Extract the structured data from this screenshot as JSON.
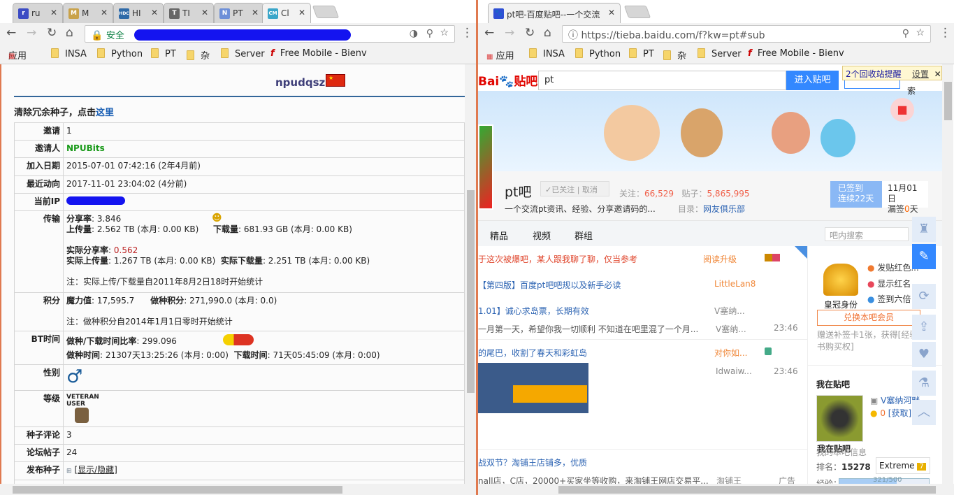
{
  "left_window": {
    "tabs": [
      {
        "label": "ru",
        "favicon": "r"
      },
      {
        "label": "M",
        "favicon": "M"
      },
      {
        "label": "HI",
        "favicon": "HDC"
      },
      {
        "label": "TI",
        "favicon": "T"
      },
      {
        "label": "PT",
        "favicon": "N"
      },
      {
        "label": "Cl",
        "favicon": "CM"
      }
    ],
    "security_label": "安全",
    "profile": {
      "username": "npudqsz",
      "clean_text": "清除冗余种子，点击",
      "clean_link": "这里",
      "rows": {
        "invite_label": "邀请",
        "invite": "1",
        "inviter_label": "邀请人",
        "inviter": "NPUBits",
        "join_label": "加入日期",
        "join": "2015-07-01 07:42:16 (2年4月前)",
        "last_label": "最近动向",
        "last": "2017-11-01 23:04:02 (4分前)",
        "ip_label": "当前IP",
        "transfer_label": "传输",
        "ratio_label": "分享率",
        "ratio": ": 3.846",
        "up_label": "上传量",
        "up": ": 2.562 TB (本月: 0.00 KB)",
        "down_label": "下载量",
        "down": ": 681.93 GB (本月: 0.00 KB)",
        "real_ratio_label": "实际分享率",
        "real_ratio": "0.562",
        "real_up_label": "实际上传量",
        "real_up": ": 1.267 TB (本月: 0.00 KB)",
        "real_down_label": "实际下载量",
        "real_down": ": 2.251 TB (本月: 0.00 KB)",
        "transfer_note": "注：实际上传/下载量自2011年8月2日18时开始统计",
        "points_label": "积分",
        "magic_label": "魔力值",
        "magic": ": 17,595.7",
        "seed_points_label": "做种积分",
        "seed_points": ": 271,990.0 (本月: 0.0)",
        "points_note": "注：做种积分自2014年1月1日零时开始统计",
        "bt_label": "BT时间",
        "bt_ratio_label": "做种/下载时间比率",
        "bt_ratio": ": 299.096",
        "seed_time_label": "做种时间",
        "seed_time": ": 21307天13:25:26 (本月: 0:00)",
        "dl_time_label": "下载时间",
        "dl_time": ": 71天05:45:09 (本月: 0:00)",
        "gender_label": "性别",
        "level_label": "等级",
        "level_badge": "VETERAN USER",
        "comments_label": "种子评论",
        "comments": "3",
        "posts_label": "论坛帖子",
        "posts": "24",
        "released_label": "发布种子",
        "released_toggle": "[显示/隐藏]"
      }
    }
  },
  "right_window": {
    "tab": "pt吧-百度贴吧--一个交流",
    "url": "https://tieba.baidu.com/f?kw=pt#sub",
    "search_value": "pt",
    "enter_button": "进入贴吧",
    "notice": "2个回收站提醒",
    "notice_settings": "设置",
    "notice_extra": "索",
    "forum": {
      "name": "pt吧",
      "follow": "✓已关注",
      "unfollow": "取消",
      "follow_count_label": "关注：",
      "follow_count": "66,529",
      "posts_label": "贴子：",
      "posts": "5,865,995",
      "desc": "一个交流pt资讯、经验、分享邀请码的...",
      "catalog_label": "目录：",
      "catalog": "网友俱乐部",
      "signed": "已签到",
      "streak": "连续22天",
      "date": "11月01日",
      "missed_pre": "漏签",
      "missed": "0",
      "missed_post": "天"
    },
    "nav": [
      "精品",
      "视频",
      "群组"
    ],
    "nav_search_placeholder": "吧内搜索",
    "threads": [
      {
        "title": "于这次被爆吧，某人跟我聊了聊，仅当参考",
        "author": "阅读升级"
      },
      {
        "title": "【第四版】百度pt吧吧规以及新手必读",
        "author": "LittleLan8"
      },
      {
        "title": "1.01】诚心求岛票，长期有效",
        "author": "V塞纳...",
        "summary": "一月第一天，希望你我一切顺利 不知道在吧里混了一个月...",
        "replier": "V塞纳...",
        "time": "23:46"
      },
      {
        "title": "的尾巴，收割了春天和彩虹岛",
        "author": "对你如...",
        "replier": "Idwaiw...",
        "time": "23:46"
      },
      {
        "title": "战双节？淘铺王店铺多，优质",
        "summary": "nall店，C店，20000+买家坐等收购，来淘铺王网店交易平...",
        "author": "淘铺王",
        "tag": "广告"
      }
    ],
    "sidebar": {
      "crown": "皇冠身份",
      "perks": [
        "发贴红色...",
        "显示红名",
        "签到六倍"
      ],
      "exchange": "兑换本吧会员",
      "gift": "赠送补签卡1张，获得[经验书购买权]",
      "my_title": "我在贴吧",
      "user": "V塞纳河畔",
      "coins": "0",
      "get": "[获取]",
      "my_info": "我的本吧信息",
      "rank_label": "排名：",
      "rank": "15278",
      "level_name": "Extreme",
      "level_num": "7",
      "exp_label": "经验：",
      "exp": "321/500",
      "exp_fraction": 0.642
    }
  },
  "bookmarks": [
    "应用",
    "INSA",
    "Python",
    "PT",
    "杂",
    "Server",
    "Free Mobile - Bienv"
  ]
}
